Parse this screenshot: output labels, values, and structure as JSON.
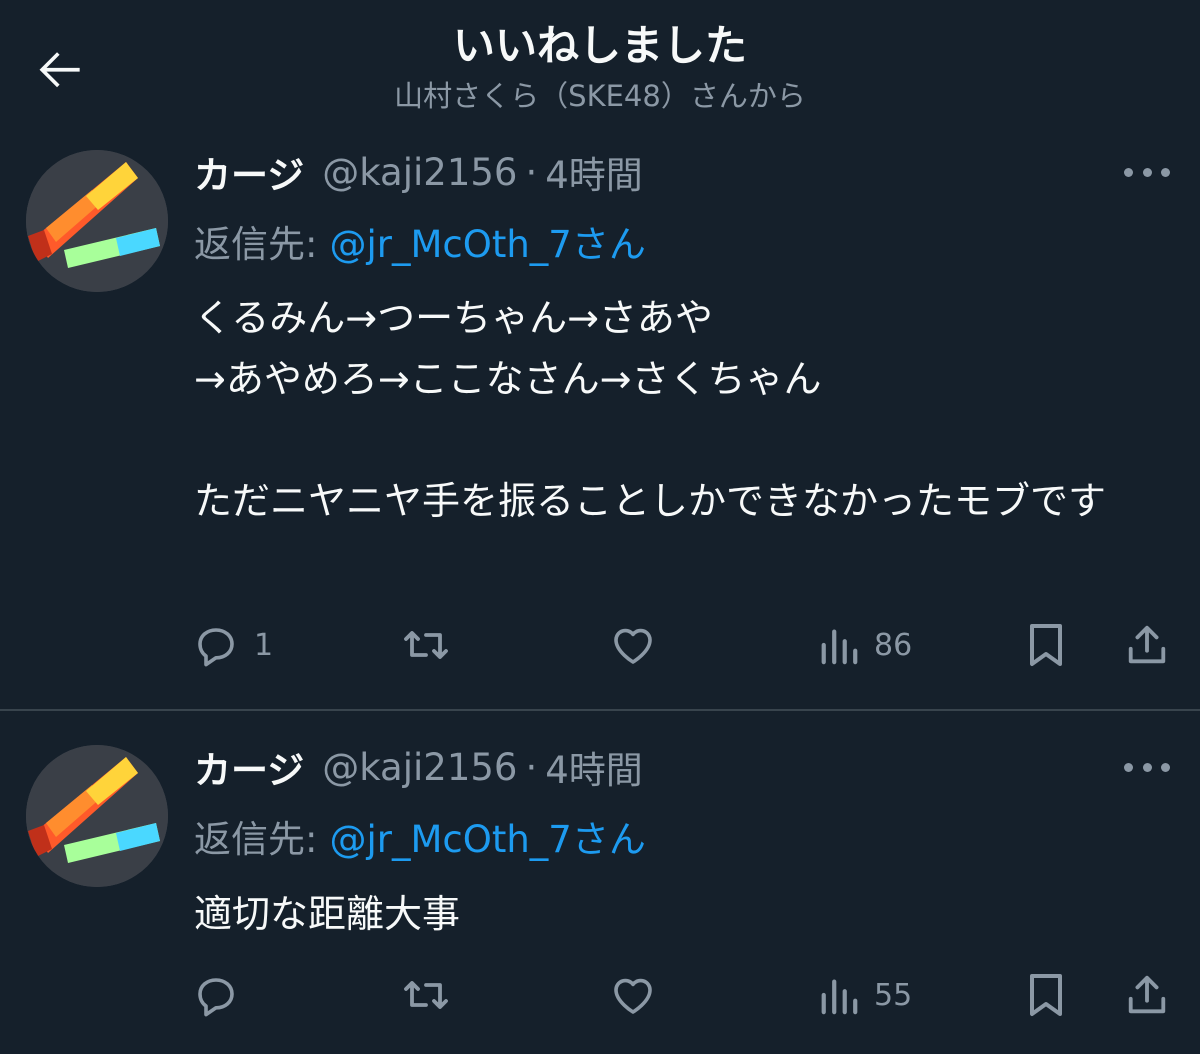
{
  "header": {
    "title": "いいねしました",
    "subtitle": "山村さくら（SKE48）さんから"
  },
  "tweets": [
    {
      "name": "カージ",
      "handle": "@kaji2156",
      "separator": "·",
      "time": "4時間",
      "reply_prefix": "返信先:",
      "reply_mention": "@jr_McOth_7さん",
      "body": "くるみん→つーちゃん→さあや\n→あやめろ→ここなさん→さくちゃん\n\nただニヤニヤ手を振ることしかできなかったモブです",
      "replies": "1",
      "retweets": "",
      "likes": "",
      "views": "86"
    },
    {
      "name": "カージ",
      "handle": "@kaji2156",
      "separator": "·",
      "time": "4時間",
      "reply_prefix": "返信先:",
      "reply_mention": "@jr_McOth_7さん",
      "body": "適切な距離大事",
      "replies": "",
      "retweets": "",
      "likes": "",
      "views": "55"
    }
  ],
  "icons": {
    "back": "arrow-left-icon",
    "more": "more-horizontal-icon",
    "reply": "reply-bubble-icon",
    "retweet": "retweet-icon",
    "like": "heart-icon",
    "views": "views-bar-chart-icon",
    "bookmark": "bookmark-icon",
    "share": "share-icon"
  },
  "colors": {
    "background": "#15202b",
    "text": "#e7e9ea",
    "secondary": "#8b98a5",
    "mention": "#1d9bf0",
    "divider": "#38444d"
  }
}
